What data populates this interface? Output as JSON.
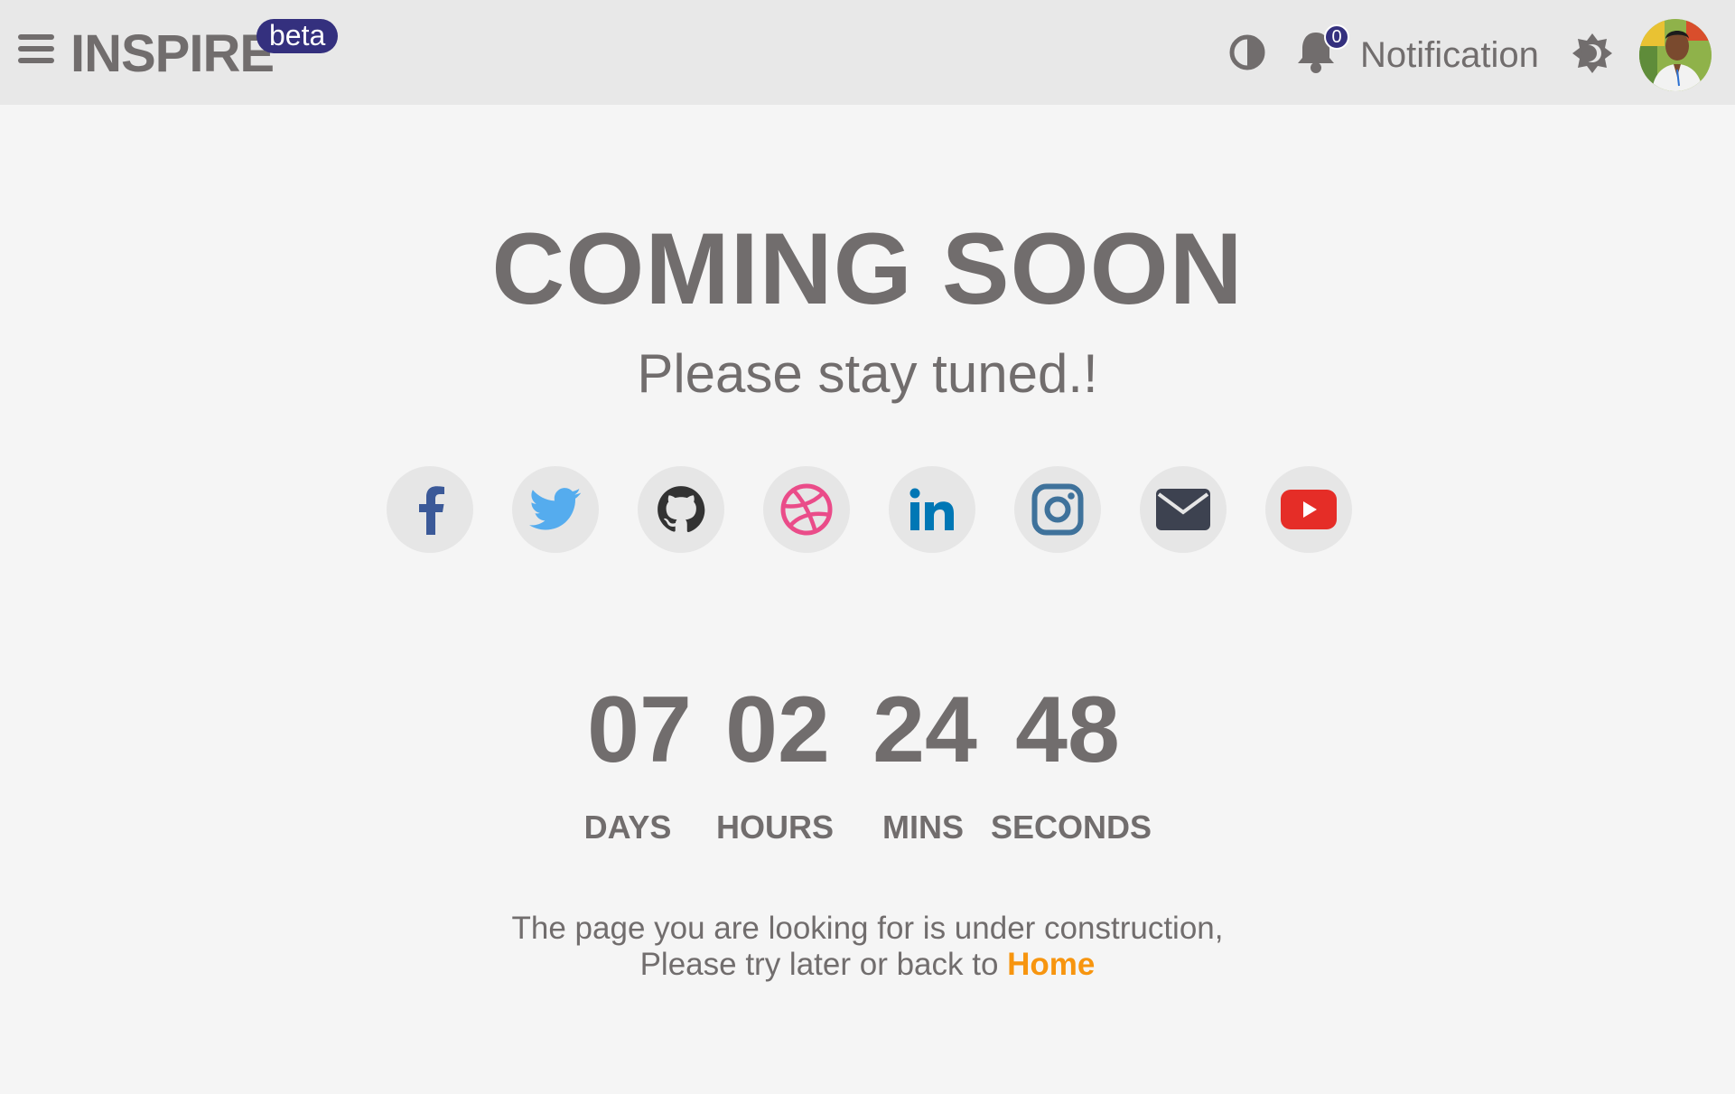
{
  "header": {
    "brand": "INSPIRE",
    "badge": "beta",
    "notification_count": "0",
    "notification_label": "Notification",
    "icons": [
      "menu-icon",
      "contrast-icon",
      "bell-icon",
      "theme-toggle-icon",
      "avatar"
    ]
  },
  "main": {
    "title": "COMING SOON",
    "subtitle": "Please stay tuned.!",
    "socials": [
      {
        "name": "facebook",
        "color": "#3b5998"
      },
      {
        "name": "twitter",
        "color": "#55acee"
      },
      {
        "name": "github",
        "color": "#333333"
      },
      {
        "name": "dribbble",
        "color": "#ea4c89"
      },
      {
        "name": "linkedin",
        "color": "#0077b5"
      },
      {
        "name": "instagram",
        "color": "#3f729b"
      },
      {
        "name": "email",
        "color": "#3d4250"
      },
      {
        "name": "youtube",
        "color": "#e52d27"
      }
    ],
    "countdown": [
      {
        "value": "07",
        "label": "DAYS"
      },
      {
        "value": "02",
        "label": "HOURS"
      },
      {
        "value": "24",
        "label": "MINS"
      },
      {
        "value": "48",
        "label": "SECONDS"
      }
    ],
    "message_line1": "The page you are looking for is under construction,",
    "message_line2": "Please try later or back to",
    "home_link": "Home"
  },
  "colors": {
    "accent": "#34307e",
    "link": "#f7950f",
    "text": "#716d6d",
    "header_bg": "#e8e8e8",
    "page_bg": "#f5f5f5"
  }
}
